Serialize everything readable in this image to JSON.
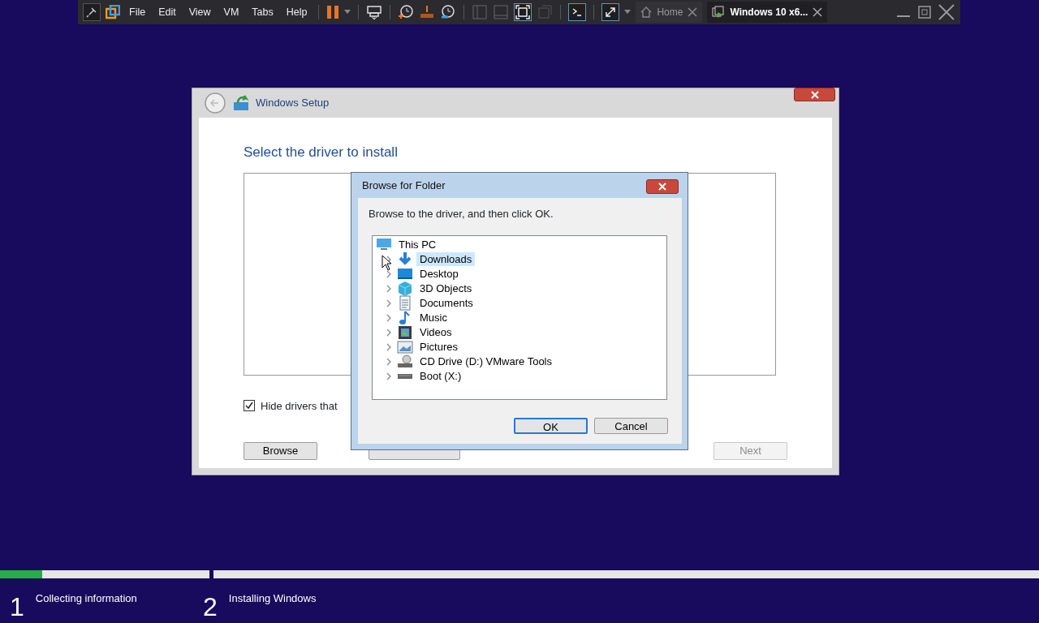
{
  "toolbar": {
    "menus": [
      "File",
      "Edit",
      "View",
      "VM",
      "Tabs",
      "Help"
    ],
    "tabs": [
      {
        "label": "Home",
        "selected": false
      },
      {
        "label": "Windows 10 x6...",
        "selected": true
      }
    ]
  },
  "setup_window": {
    "title": "Windows Setup",
    "heading": "Select the driver to install",
    "checkbox": {
      "label": "Hide drivers that",
      "checked": true
    },
    "buttons": [
      {
        "label": "Browse",
        "disabled": false
      },
      {
        "disabled": false
      },
      {
        "label": "Next",
        "disabled": true
      }
    ]
  },
  "dialog": {
    "title": "Browse for Folder",
    "instruction": "Browse to the driver, and then click OK.",
    "tree": [
      {
        "label": "This PC",
        "kind": "pc",
        "expanded": true,
        "selected": false,
        "children": [
          {
            "label": "Downloads",
            "kind": "downloads",
            "expanded": false,
            "selected": true
          },
          {
            "label": "Desktop",
            "kind": "desktop",
            "expanded": false,
            "selected": false
          },
          {
            "label": "3D Objects",
            "kind": "objects",
            "expanded": false,
            "selected": false
          },
          {
            "label": "Documents",
            "kind": "documents",
            "expanded": false,
            "selected": false
          },
          {
            "label": "Music",
            "kind": "music",
            "expanded": false,
            "selected": false
          },
          {
            "label": "Videos",
            "kind": "videos",
            "expanded": false,
            "selected": false
          },
          {
            "label": "Pictures",
            "kind": "pictures",
            "expanded": false,
            "selected": false
          },
          {
            "label": "CD Drive (D:) VMware Tools",
            "kind": "cd",
            "expanded": false,
            "selected": false
          },
          {
            "label": "Boot (X:)",
            "kind": "drive",
            "expanded": false,
            "selected": false
          }
        ]
      }
    ],
    "buttons": [
      {
        "label": "OK",
        "default": true
      },
      {
        "label": "Cancel",
        "default": false
      }
    ]
  },
  "progress": [
    {
      "number": "1",
      "label": "Collecting information",
      "level": 0.2
    },
    {
      "number": "2",
      "label": "Installing Windows",
      "level": 0
    }
  ]
}
